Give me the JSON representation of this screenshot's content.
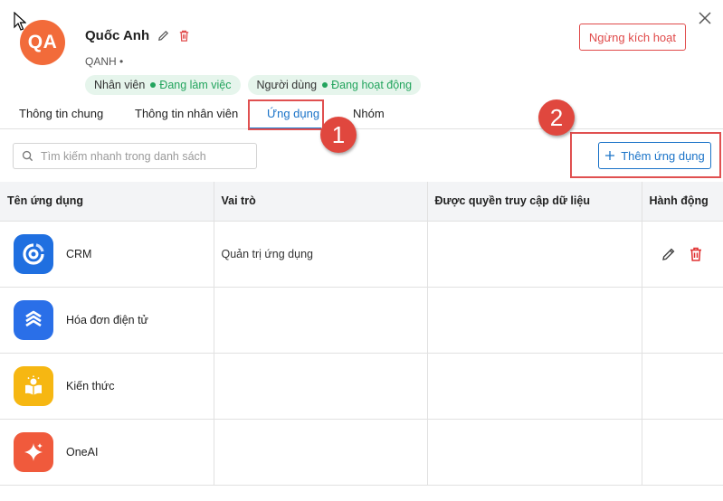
{
  "profile": {
    "avatar_initials": "QA",
    "name": "Quốc Anh",
    "username": "QANH •",
    "deactivate_label": "Ngừng kích hoạt",
    "badges": [
      {
        "label": "Nhân viên",
        "status": "Đang làm việc"
      },
      {
        "label": "Người dùng",
        "status": "Đang hoạt động"
      }
    ]
  },
  "tabs": [
    {
      "label": "Thông tin chung"
    },
    {
      "label": "Thông tin nhân viên"
    },
    {
      "label": "Ứng dụng"
    },
    {
      "label": "Nhóm"
    }
  ],
  "search": {
    "placeholder": "Tìm kiếm nhanh trong danh sách"
  },
  "add_button": {
    "label": "Thêm ứng dụng"
  },
  "annotations": {
    "step1": "1",
    "step2": "2"
  },
  "table": {
    "headers": [
      "Tên ứng dụng",
      "Vai trò",
      "Được quyền truy cập dữ liệu",
      "Hành động"
    ],
    "rows": [
      {
        "app": "CRM",
        "role": "Quản trị ứng dụng",
        "access": "",
        "icon": "crm-icon"
      },
      {
        "app": "Hóa đơn điện tử",
        "role": "",
        "access": "",
        "icon": "e-invoice-icon"
      },
      {
        "app": "Kiến thức",
        "role": "",
        "access": "",
        "icon": "knowledge-icon"
      },
      {
        "app": "OneAI",
        "role": "",
        "access": "",
        "icon": "oneai-icon"
      }
    ]
  },
  "colors": {
    "accent": "#1a73c8",
    "danger": "#e04a4a",
    "success": "#22a45d",
    "avatar": "#f26b3a",
    "annotation": "#e0473e"
  }
}
